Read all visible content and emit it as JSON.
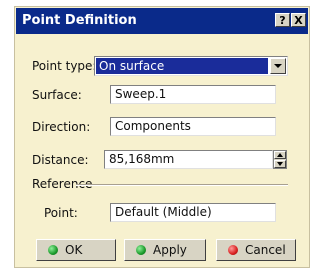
{
  "window": {
    "title": "Point Definition",
    "help_glyph": "?",
    "close_glyph": "X"
  },
  "form": {
    "point_type": {
      "label": "Point type:",
      "value": "On surface"
    },
    "surface": {
      "label": "Surface:",
      "value": "Sweep.1"
    },
    "direction": {
      "label": "Direction:",
      "value": "Components"
    },
    "distance": {
      "label": "Distance:",
      "value": "85,168mm"
    },
    "reference": {
      "group_label": "Reference",
      "point_label": "Point:",
      "point_value": "Default (Middle)"
    }
  },
  "buttons": {
    "ok": {
      "label": "OK",
      "icon": "green-dot-icon",
      "color": "#1a9a2a"
    },
    "apply": {
      "label": "Apply",
      "icon": "green-dot-icon",
      "color": "#1a9a2a"
    },
    "cancel": {
      "label": "Cancel",
      "icon": "red-dot-icon",
      "color": "#d81e1e"
    }
  },
  "colors": {
    "titlebar": "#0a2a8a",
    "selection": "#1a2c9a",
    "dialog_bg": "#f7f1cf"
  }
}
